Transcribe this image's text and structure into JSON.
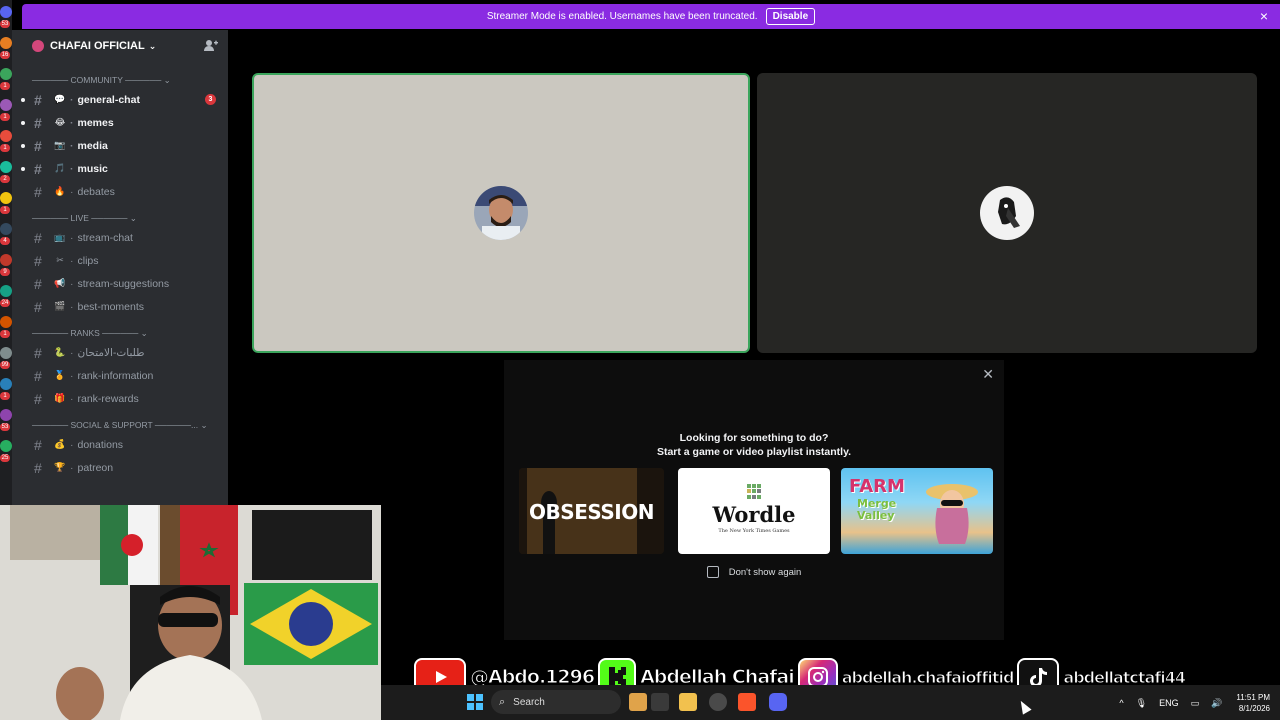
{
  "banner": {
    "message": "Streamer Mode is enabled. Usernames have been truncated.",
    "disable_label": "Disable",
    "close_icon": "×"
  },
  "server": {
    "name": "CHAFAI OFFICIAL",
    "chevron": "⌄",
    "invite_icon": "👤+"
  },
  "categories": {
    "community": "────── COMMUNITY ────── ⌄",
    "live": "────── LIVE ────── ⌄",
    "ranks": "────── RANKS ────── ⌄",
    "social": "────── SOCIAL & SUPPORT ──────... ⌄"
  },
  "channels": {
    "community": [
      {
        "emoji": "💬",
        "name": "general-chat",
        "mention": "3"
      },
      {
        "emoji": "😂",
        "name": "memes"
      },
      {
        "emoji": "📷",
        "name": "media"
      },
      {
        "emoji": "🎵",
        "name": "music"
      },
      {
        "emoji": "🔥",
        "name": "debates"
      }
    ],
    "live": [
      {
        "emoji": "📺",
        "name": "stream-chat"
      },
      {
        "emoji": "✂",
        "name": "clips"
      },
      {
        "emoji": "📢",
        "name": "stream-suggestions"
      },
      {
        "emoji": "🎬",
        "name": "best-moments"
      }
    ],
    "ranks": [
      {
        "emoji": "🐍",
        "name": "طلبات-الامتحان"
      },
      {
        "emoji": "🏅",
        "name": "rank-information"
      },
      {
        "emoji": "🎁",
        "name": "rank-rewards"
      }
    ],
    "social": [
      {
        "emoji": "💰",
        "name": "donations"
      },
      {
        "emoji": "🏆",
        "name": "patreon"
      }
    ]
  },
  "modal": {
    "close_icon": "✕",
    "heading_line1": "Looking for something to do?",
    "heading_line2": "Start a game or video playlist instantly.",
    "games": [
      {
        "title": "OBSESSION"
      },
      {
        "title": "Wordle",
        "subtitle": "The New York Times Games"
      },
      {
        "title": "FARM",
        "subtitle": "Merge Valley"
      }
    ],
    "dont_show": "Don't show again"
  },
  "social": {
    "youtube": "@Abdo.1296",
    "kick": "Abdellah Chafai",
    "instagram": "abdellah.chafaioffitid",
    "tiktok": "abdellatctafi44"
  },
  "taskbar": {
    "search_placeholder": "Search",
    "language": "ENG",
    "time": "11:51 PM",
    "date": "8/1/2026"
  },
  "rail_badges": [
    "53",
    "16",
    "1",
    "1",
    "1",
    "2",
    "1",
    "4",
    "9",
    "24",
    "1",
    "99",
    "1",
    "53",
    "25"
  ],
  "colors": {
    "banner": "#8a2be2",
    "speaking_border": "#3ba55c",
    "mention": "#da373c"
  }
}
